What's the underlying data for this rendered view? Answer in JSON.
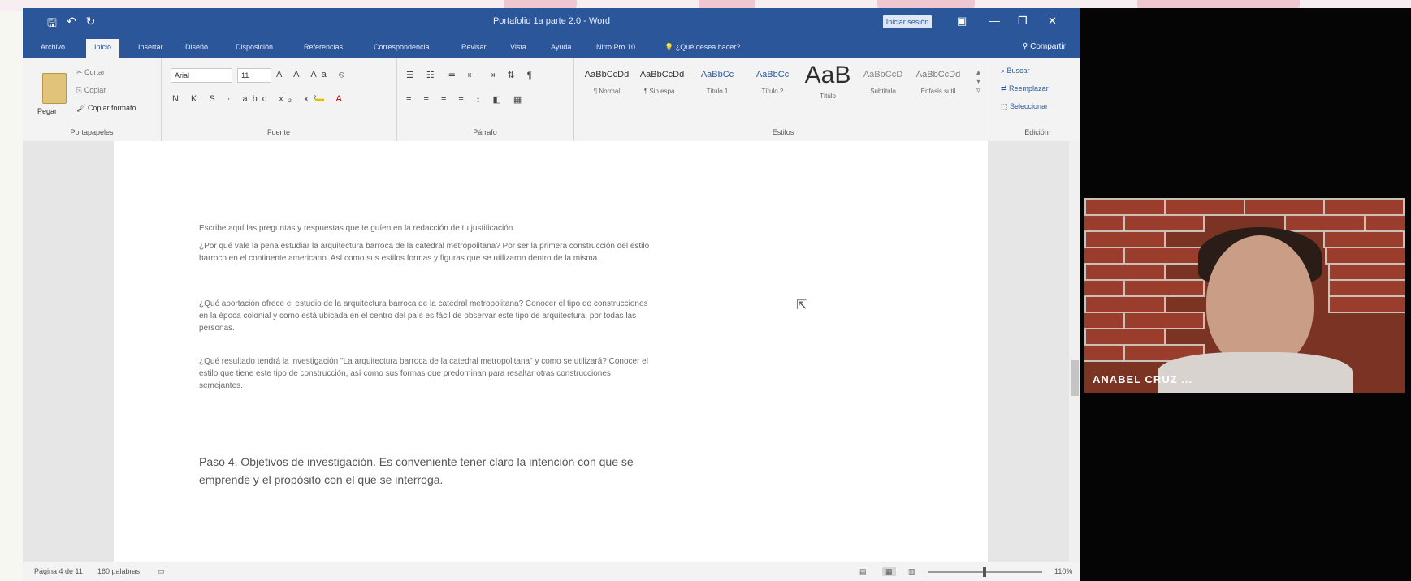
{
  "window": {
    "title": "Portafolio 1a parte 2.0 - Word",
    "signin": "Iniciar sesión",
    "controls": [
      "▣",
      "—",
      "❐",
      "✕"
    ]
  },
  "quick_access": [
    "save-icon",
    "undo-icon",
    "redo-icon"
  ],
  "tabs": [
    "Archivo",
    "Inicio",
    "Insertar",
    "Diseño",
    "Disposición",
    "Referencias",
    "Correspondencia",
    "Revisar",
    "Vista",
    "Ayuda",
    "Nitro Pro 10",
    "¿Qué desea hacer?"
  ],
  "share_label": "Compartir",
  "ribbon": {
    "clipboard": {
      "paste": "Pegar",
      "cut": "Cortar",
      "copy": "Copiar",
      "format": "Copiar formato",
      "label": "Portapapeles"
    },
    "font": {
      "name": "Arial",
      "size": "11",
      "row2": "N K S · abc x₂ x²",
      "label": "Fuente"
    },
    "paragraph": {
      "label": "Párrafo"
    },
    "styles": {
      "items": [
        {
          "sample": "AaBbCcDd",
          "name": "¶ Normal"
        },
        {
          "sample": "AaBbCcDd",
          "name": "¶ Sin espa..."
        },
        {
          "sample": "AaBbCc",
          "name": "Título 1"
        },
        {
          "sample": "AaBbCc",
          "name": "Título 2"
        },
        {
          "sample": "AaB",
          "name": "Título"
        },
        {
          "sample": "AaBbCcD",
          "name": "Subtítulo"
        },
        {
          "sample": "AaBbCcDd",
          "name": "Énfasis sutil"
        }
      ],
      "label": "Estilos"
    },
    "editing": {
      "find": "Buscar",
      "replace": "Reemplazar",
      "select": "Seleccionar",
      "label": "Edición"
    }
  },
  "document": {
    "paragraphs": [
      "Escribe aquí las preguntas y respuestas que te guíen en la redacción de tu justificación.",
      "¿Por qué vale la pena estudiar la arquitectura barroca de la catedral metropolitana? Por ser la primera construcción del estilo barroco en el continente americano. Así como sus estilos formas y figuras que se utilizaron dentro de la misma.",
      "¿Qué aportación ofrece el estudio de la arquitectura barroca de la catedral metropolitana? Conocer el tipo de construcciones en la época colonial y como está ubicada en el centro del país es fácil de observar este tipo de arquitectura, por todas las personas.",
      "¿Qué resultado tendrá la investigación \"La arquitectura barroca de la catedral metropolitana\" y como se utilizará? Conocer el estilo que tiene este tipo de construcción, así como sus formas que predominan para resaltar otras construcciones semejantes."
    ],
    "heading": "Paso 4. Objetivos de investigación. Es conveniente tener claro la intención con que se emprende y el propósito con el que se interroga."
  },
  "status": {
    "page": "Página 4 de 11",
    "words": "160 palabras",
    "zoom": "110%",
    "zoom_level": 0.48
  },
  "video": {
    "participant": "ANABEL CRUZ ..."
  }
}
